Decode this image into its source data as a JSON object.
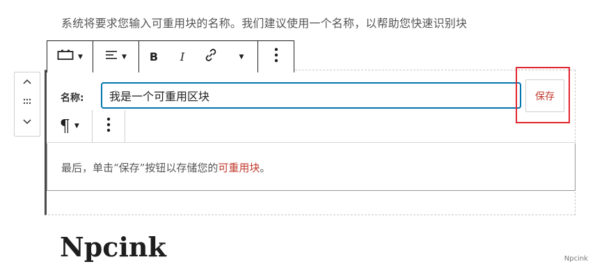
{
  "intro_text": "系统将要求您输入可重用块的名称。我们建议使用一个名称，以帮助您快速识别块",
  "mover": {
    "up_icon": "chevron-up-icon",
    "drag_icon": "drag-handle-icon",
    "down_icon": "chevron-down-icon"
  },
  "toolbar": {
    "block_type_icon": "reusable-block-icon",
    "align_icon": "align-left-icon",
    "bold_label": "B",
    "italic_label": "I",
    "link_icon": "link-icon",
    "more_icon": "more-vertical-icon"
  },
  "name_row": {
    "label": "名称:",
    "input_value": "我是一个可重用区块",
    "save_label": "保存"
  },
  "paragraph_toolbar": {
    "paragraph_label": "¶",
    "more_icon": "more-vertical-icon"
  },
  "content": {
    "text_before": "最后，单击“保存”按钮以存储您的",
    "highlight": "可重用块",
    "text_after": "。"
  },
  "heading": "Npcink",
  "watermark": "Npcink",
  "colors": {
    "accent_blue": "#0075af",
    "highlight_red": "#c0392b",
    "callout_red": "#e0232d"
  }
}
